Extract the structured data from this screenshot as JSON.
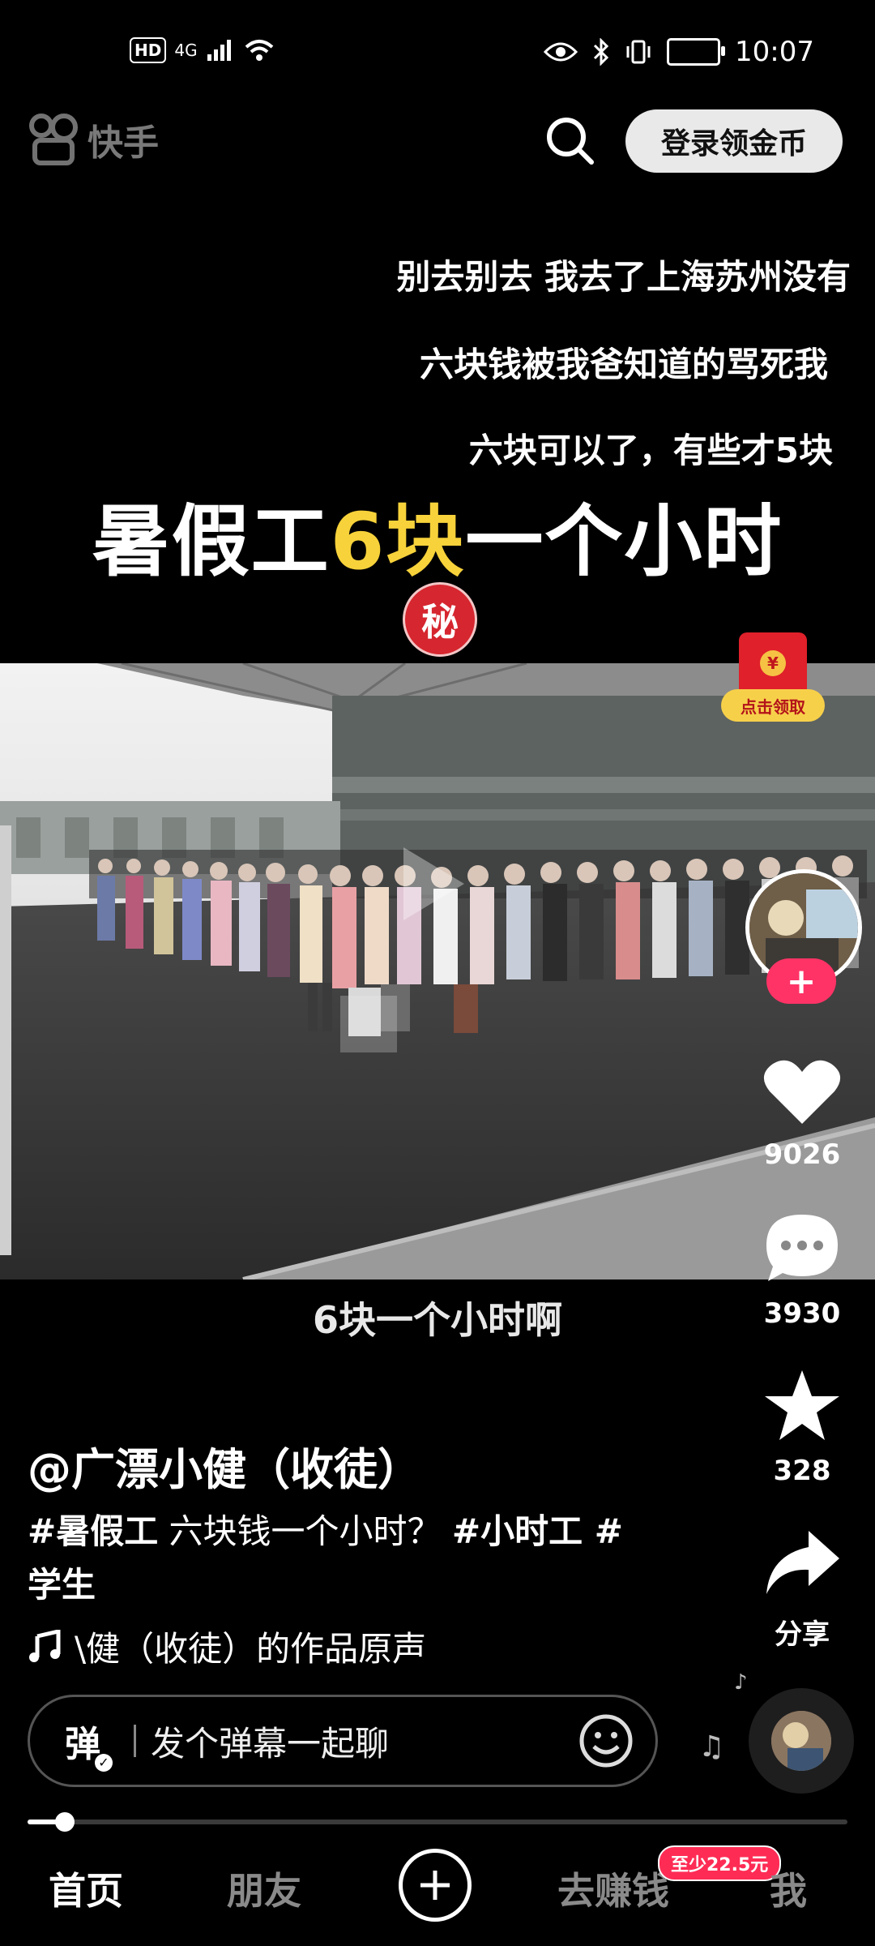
{
  "status_bar": {
    "hd": "HD",
    "network": "4G",
    "time": "10:07"
  },
  "header": {
    "logo_text": "快手",
    "login_button": "登录领金币"
  },
  "overlay_comments": [
    "别去别去 我去了上海苏州没有",
    "六块钱被我爸知道的骂死我",
    "六块可以了，有些才5块"
  ],
  "banner": {
    "part1": "暑假工",
    "highlight": "6块",
    "part2": "一个小时",
    "secret_badge": "秘"
  },
  "video": {
    "subtitle": "6块一个小时啊"
  },
  "red_envelope": {
    "label": "点击领取",
    "coin": "¥"
  },
  "rail": {
    "likes": "9026",
    "comments": "3930",
    "favorites": "328",
    "share": "分享"
  },
  "post": {
    "author": "@广漂小健（收徒）",
    "desc_parts": [
      "#暑假工",
      " 六块钱一个小时？ ",
      "#小时工",
      " #",
      "学生"
    ],
    "music": "\\健（收徒）的作品原声"
  },
  "comment_bar": {
    "dan": "弹",
    "placeholder": "发个弹幕一起聊"
  },
  "progress": {
    "fraction": 0.045
  },
  "tabs": {
    "home": "首页",
    "friends": "朋友",
    "earn": "去赚钱",
    "me": "我",
    "earn_badge": "至少22.5元"
  },
  "colors": {
    "highlight": "#f7d23a",
    "accent": "#fe2c55",
    "envelope": "#e0202a"
  }
}
